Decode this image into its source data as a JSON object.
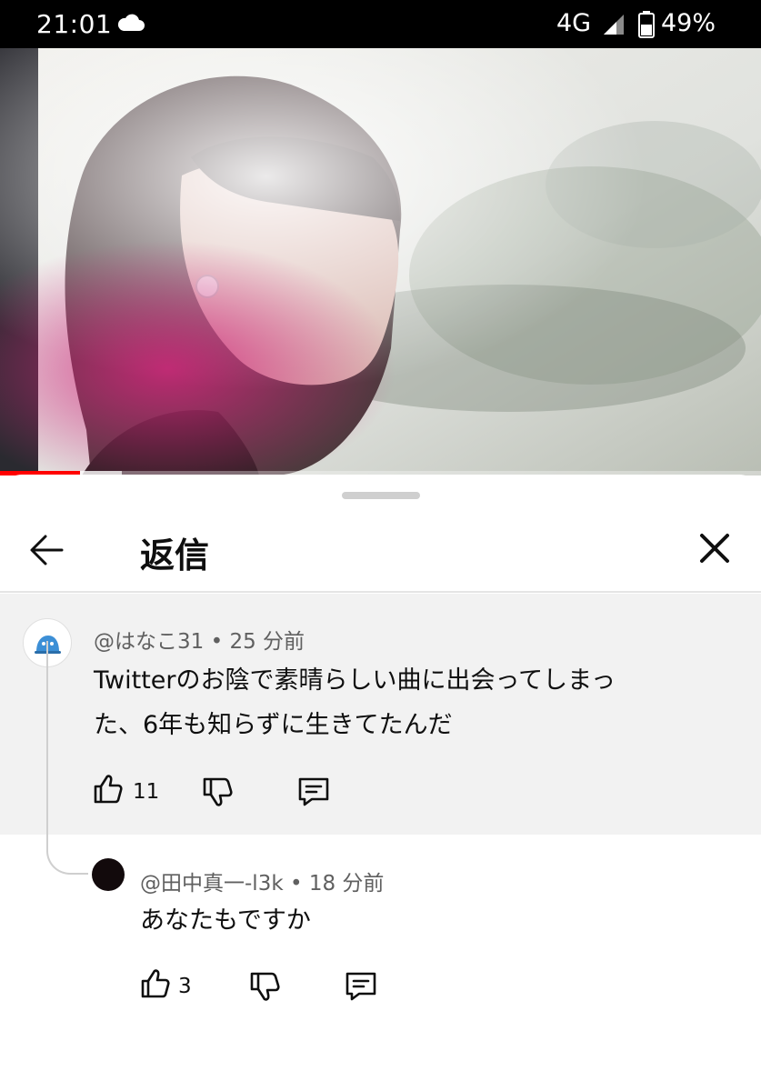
{
  "status_bar": {
    "time": "21:01",
    "weather_icon": "cloud-icon",
    "network": "4G",
    "signal_icon": "signal-icon",
    "battery_icon": "battery-icon",
    "battery_percent": "49%"
  },
  "video": {
    "progress_played_fraction": 0.105,
    "progress_buffered_fraction": 0.16
  },
  "sheet": {
    "title": "返信",
    "back_icon": "arrow-left-icon",
    "close_icon": "close-icon"
  },
  "parent_comment": {
    "author": "@はなこ31",
    "time": "25 分前",
    "text_lines": [
      "Twitterのお陰で素晴らしい曲に出会ってしまっ",
      "た、6年も知らずに生きてたんだ"
    ],
    "like_count": "11",
    "icons": [
      "thumbs-up-icon",
      "thumbs-down-icon",
      "reply-icon"
    ]
  },
  "reply_comment": {
    "author": "@田中真一-l3k",
    "time": "18 分前",
    "text": "あなたもですか",
    "like_count": "3",
    "icons": [
      "thumbs-up-icon",
      "thumbs-down-icon",
      "reply-icon"
    ]
  },
  "meta_separator": " • ",
  "colors": {
    "status_bar_bg": "#000000",
    "progress_red": "#ff0000",
    "parent_comment_bg": "#f2f2f2",
    "text_primary": "#0f0f0f",
    "text_secondary": "#606060"
  }
}
